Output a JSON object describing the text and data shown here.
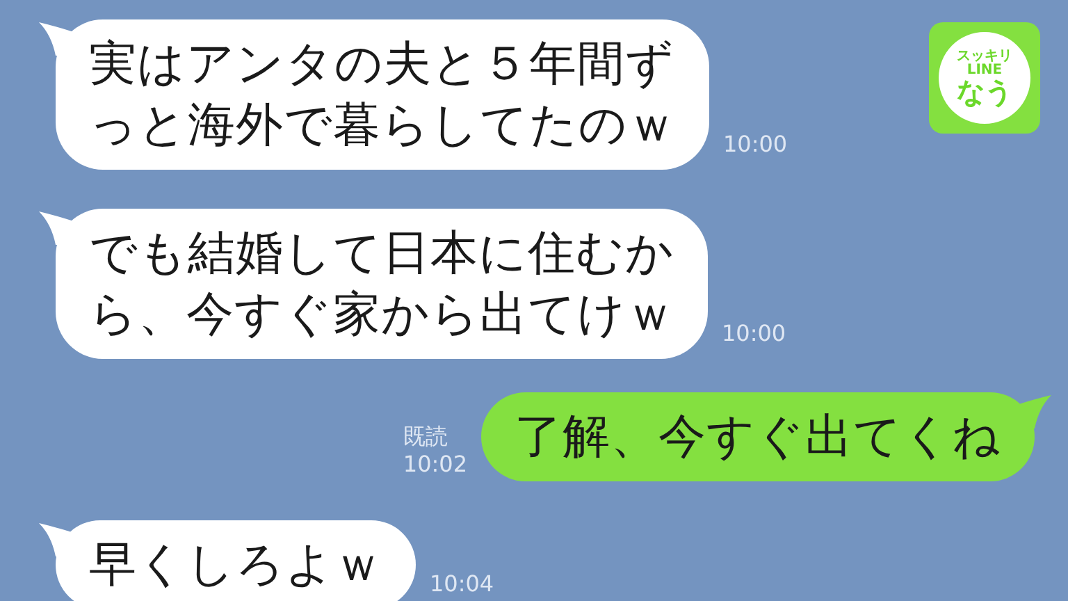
{
  "logo": {
    "lines": [
      "スッキリ",
      "LINE",
      "なう"
    ]
  },
  "messages": [
    {
      "kind": "received",
      "lines": [
        "実はアンタの夫と５年間ず",
        "っと海外で暮らしてたのｗ"
      ],
      "time": "10:00"
    },
    {
      "kind": "received",
      "lines": [
        "でも結婚して日本に住むか",
        "ら、今すぐ家から出てけｗ"
      ],
      "time": "10:00"
    },
    {
      "kind": "sent",
      "lines": [
        "了解、今すぐ出てくね"
      ],
      "read": "既読",
      "time": "10:02"
    },
    {
      "kind": "received",
      "lines": [
        "早くしろよｗ"
      ],
      "time": "10:04"
    }
  ]
}
